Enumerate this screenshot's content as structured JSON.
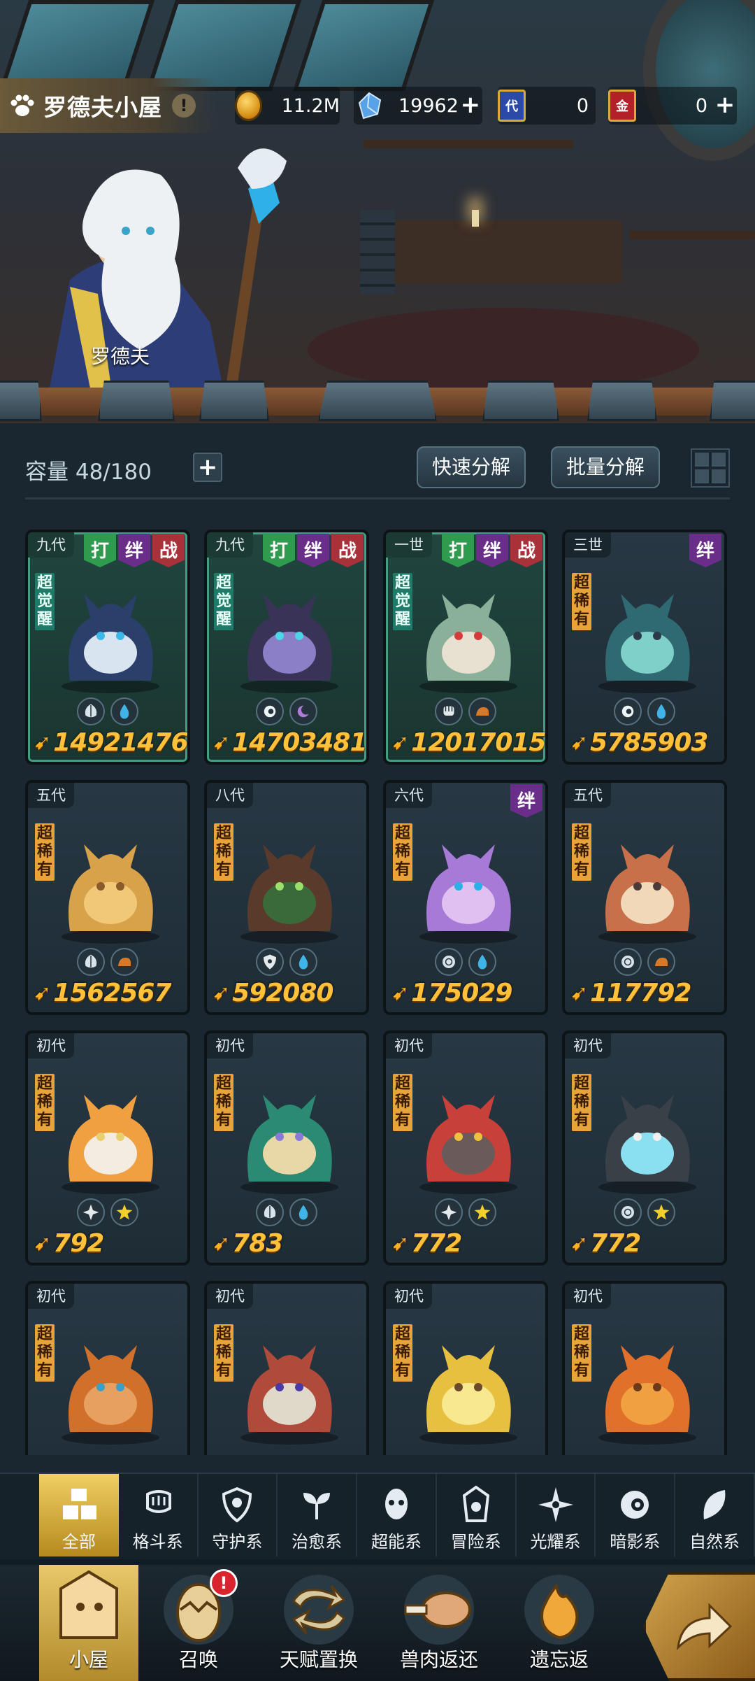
{
  "header": {
    "house_title": "罗德夫小屋",
    "info_label": "!",
    "resources": {
      "gold": "11.2M",
      "gems": "19962",
      "ticket_generation": "0",
      "ticket_gold": "0",
      "ticket_generation_glyph": "代",
      "ticket_gold_glyph": "金"
    },
    "npc_name": "罗德夫"
  },
  "storage": {
    "capacity_label": "容量 48/180",
    "add_label": "+",
    "quick_decompose": "快速分解",
    "batch_decompose": "批量分解"
  },
  "tags": {
    "fight": "打",
    "bond": "绊",
    "war": "战"
  },
  "rarity": {
    "awakened": "超觉醒",
    "super_rare": "超稀有"
  },
  "pets": [
    {
      "gen": "九代",
      "tags": [
        "fight",
        "bond",
        "war"
      ],
      "rarity": "awakened",
      "elements": [
        "leaf",
        "water"
      ],
      "power": "14921476"
    },
    {
      "gen": "九代",
      "tags": [
        "fight",
        "bond",
        "war"
      ],
      "rarity": "awakened",
      "elements": [
        "eye",
        "moon"
      ],
      "power": "14703481"
    },
    {
      "gen": "一世",
      "tags": [
        "fight",
        "bond",
        "war"
      ],
      "rarity": "awakened",
      "elements": [
        "fist",
        "earth"
      ],
      "power": "12017015"
    },
    {
      "gen": "三世",
      "tags": [
        "bond"
      ],
      "rarity": "super_rare",
      "elements": [
        "eye",
        "water"
      ],
      "power": "5785903"
    },
    {
      "gen": "五代",
      "tags": [],
      "rarity": "super_rare",
      "elements": [
        "leaf",
        "earth"
      ],
      "power": "1562567"
    },
    {
      "gen": "八代",
      "tags": [],
      "rarity": "super_rare",
      "elements": [
        "shield",
        "water"
      ],
      "power": "592080"
    },
    {
      "gen": "六代",
      "tags": [
        "bond"
      ],
      "rarity": "super_rare",
      "elements": [
        "psychic",
        "water"
      ],
      "power": "175029"
    },
    {
      "gen": "五代",
      "tags": [],
      "rarity": "super_rare",
      "elements": [
        "psychic",
        "earth"
      ],
      "power": "117792"
    },
    {
      "gen": "初代",
      "tags": [],
      "rarity": "super_rare",
      "elements": [
        "light",
        "star"
      ],
      "power": "792"
    },
    {
      "gen": "初代",
      "tags": [],
      "rarity": "super_rare",
      "elements": [
        "leaf",
        "water"
      ],
      "power": "783"
    },
    {
      "gen": "初代",
      "tags": [],
      "rarity": "super_rare",
      "elements": [
        "light",
        "star"
      ],
      "power": "772"
    },
    {
      "gen": "初代",
      "tags": [],
      "rarity": "super_rare",
      "elements": [
        "psychic",
        "star"
      ],
      "power": "772"
    },
    {
      "gen": "初代",
      "tags": [],
      "rarity": "super_rare",
      "elements": [],
      "power": ""
    },
    {
      "gen": "初代",
      "tags": [],
      "rarity": "super_rare",
      "elements": [],
      "power": ""
    },
    {
      "gen": "初代",
      "tags": [],
      "rarity": "super_rare",
      "elements": [],
      "power": ""
    },
    {
      "gen": "初代",
      "tags": [],
      "rarity": "super_rare",
      "elements": [],
      "power": ""
    }
  ],
  "categories": [
    {
      "label": "全部",
      "icon": "all-icon",
      "active": true
    },
    {
      "label": "格斗系",
      "icon": "fist-icon"
    },
    {
      "label": "守护系",
      "icon": "shield-icon"
    },
    {
      "label": "治愈系",
      "icon": "sprout-icon"
    },
    {
      "label": "超能系",
      "icon": "psychic-icon"
    },
    {
      "label": "冒险系",
      "icon": "lantern-icon"
    },
    {
      "label": "光耀系",
      "icon": "star-cross-icon"
    },
    {
      "label": "暗影系",
      "icon": "eye-icon"
    },
    {
      "label": "自然系",
      "icon": "leaf-icon"
    }
  ],
  "nav": [
    {
      "label": "小屋",
      "icon": "house-icon",
      "active": true
    },
    {
      "label": "召唤",
      "icon": "egg-icon",
      "badge": "!"
    },
    {
      "label": "天赋置换",
      "icon": "swap-icon"
    },
    {
      "label": "兽肉返还",
      "icon": "meat-icon"
    },
    {
      "label": "遗忘返",
      "icon": "flame-icon"
    }
  ],
  "colors": {
    "gold_accent": "#ffc13a",
    "awakened_frame": "#3f9e83",
    "tag_fight": "#2f9b4e",
    "tag_bond": "#6a2e8a",
    "tag_war": "#a8323a",
    "rarity_badge": "#e8a33a",
    "active_tab": "#f1cf63"
  }
}
